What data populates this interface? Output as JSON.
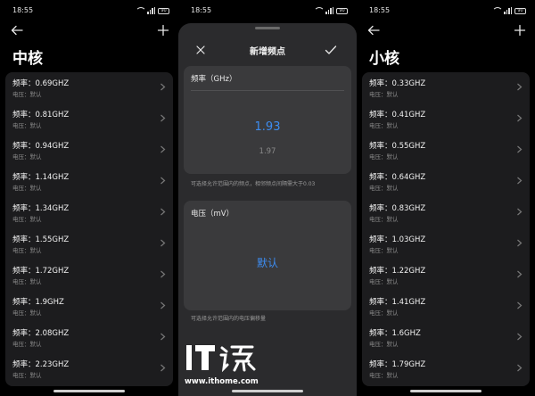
{
  "colors": {
    "accent": "#3d8cf0",
    "card_bg": "#1c1c1e",
    "sheet_bg": "#2b2b2d",
    "box_bg": "#3a3a3c"
  },
  "status": {
    "time": "18:55",
    "battery": "90"
  },
  "left_screen": {
    "title": "中核",
    "items": [
      {
        "freq": "频率：0.69GHZ",
        "volt": "电压：默认"
      },
      {
        "freq": "频率：0.81GHZ",
        "volt": "电压：默认"
      },
      {
        "freq": "频率：0.94GHZ",
        "volt": "电压：默认"
      },
      {
        "freq": "频率：1.14GHZ",
        "volt": "电压：默认"
      },
      {
        "freq": "频率：1.34GHZ",
        "volt": "电压：默认"
      },
      {
        "freq": "频率：1.55GHZ",
        "volt": "电压：默认"
      },
      {
        "freq": "频率：1.72GHZ",
        "volt": "电压：默认"
      },
      {
        "freq": "频率：1.9GHZ",
        "volt": "电压：默认"
      },
      {
        "freq": "频率：2.08GHZ",
        "volt": "电压：默认"
      },
      {
        "freq": "频率：2.23GHZ",
        "volt": "电压：默认"
      }
    ]
  },
  "middle_screen": {
    "dialog_title": "新增频点",
    "freq_label": "频率（GHz）",
    "freq_selected": "1.93",
    "freq_next": "1.97",
    "freq_hint": "可选择允许范围内的频点，相邻频点间隔需大于0.03",
    "voltage_label": "电压（mV）",
    "voltage_value": "默认",
    "voltage_hint": "可选择允许范围内的电压偏移量",
    "watermark_site": "www.ithome.com"
  },
  "right_screen": {
    "title": "小核",
    "items": [
      {
        "freq": "频率：0.33GHZ",
        "volt": "电压：默认"
      },
      {
        "freq": "频率：0.41GHZ",
        "volt": "电压：默认"
      },
      {
        "freq": "频率：0.55GHZ",
        "volt": "电压：默认"
      },
      {
        "freq": "频率：0.64GHZ",
        "volt": "电压：默认"
      },
      {
        "freq": "频率：0.83GHZ",
        "volt": "电压：默认"
      },
      {
        "freq": "频率：1.03GHZ",
        "volt": "电压：默认"
      },
      {
        "freq": "频率：1.22GHZ",
        "volt": "电压：默认"
      },
      {
        "freq": "频率：1.41GHZ",
        "volt": "电压：默认"
      },
      {
        "freq": "频率：1.6GHZ",
        "volt": "电压：默认"
      },
      {
        "freq": "频率：1.79GHZ",
        "volt": "电压：默认"
      }
    ]
  }
}
